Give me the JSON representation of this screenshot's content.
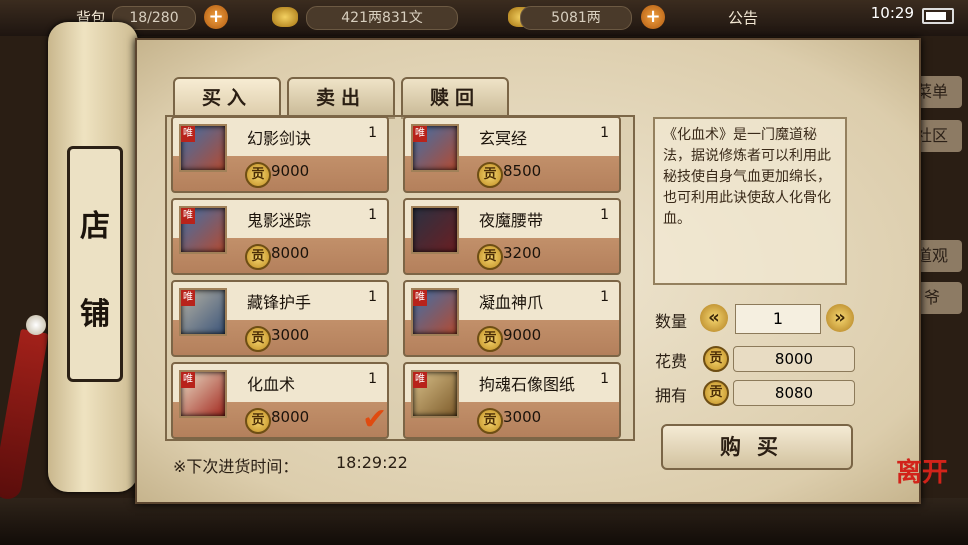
{
  "topbar": {
    "bag_label": "背包",
    "bag_count": "18/280",
    "silver": "421两831文",
    "gold": "5081两",
    "notice_label": "公告",
    "clock": "10:29"
  },
  "side_buttons": [
    "菜单",
    "社区",
    "道观",
    "爷"
  ],
  "scroll_title": [
    "店",
    "铺"
  ],
  "tabs": [
    {
      "label": "买入",
      "active": true
    },
    {
      "label": "卖出",
      "active": false
    },
    {
      "label": "赎回",
      "active": false
    }
  ],
  "items": [
    {
      "name": "幻影剑诀",
      "qty": "1",
      "price": "9000",
      "badge": "唯",
      "icon": "book-icon"
    },
    {
      "name": "玄冥经",
      "qty": "1",
      "price": "8500",
      "badge": "唯",
      "icon": "book-icon"
    },
    {
      "name": "鬼影迷踪",
      "qty": "1",
      "price": "8000",
      "badge": "唯",
      "icon": "book-icon"
    },
    {
      "name": "夜魔腰带",
      "qty": "1",
      "price": "3200",
      "badge": "",
      "icon": "belt-icon"
    },
    {
      "name": "藏锋护手",
      "qty": "1",
      "price": "3000",
      "badge": "唯",
      "icon": "glove-icon"
    },
    {
      "name": "凝血神爪",
      "qty": "1",
      "price": "9000",
      "badge": "唯",
      "icon": "book-icon"
    },
    {
      "name": "化血术",
      "qty": "1",
      "price": "8000",
      "badge": "唯",
      "icon": "scroll-icon"
    },
    {
      "name": "拘魂石像图纸",
      "qty": "1",
      "price": "3000",
      "badge": "唯",
      "icon": "blueprint-icon"
    }
  ],
  "coin_glyph": "贡",
  "restock": {
    "label": "※下次进货时间：",
    "time": "18:29:22"
  },
  "description": "《化血术》是一门魔道秘法，据说修炼者可以利用此秘技使自身气血更加绵长，也可利用此诀使敌人化骨化血。",
  "purchase": {
    "qty_label": "数量",
    "qty_value": "1",
    "cost_label": "花费",
    "cost_value": "8000",
    "own_label": "拥有",
    "own_value": "8080",
    "buy_label": "购买"
  },
  "logo_text": "离开",
  "colors": {
    "accent": "#b8231b",
    "coin": "#f6d771",
    "parchment": "#efe6d1"
  }
}
